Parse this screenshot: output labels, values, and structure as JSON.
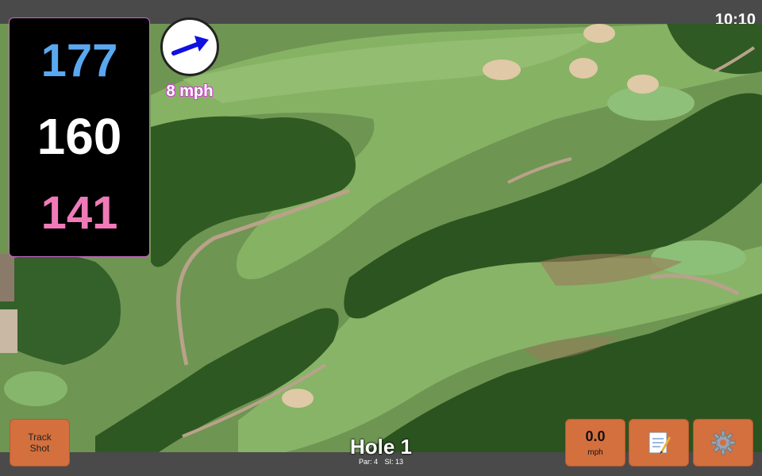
{
  "status": {
    "time": "10:10"
  },
  "distances": {
    "back": "177",
    "middle": "160",
    "front": "141",
    "colors": {
      "back": "#5aa8f0",
      "middle": "#ffffff",
      "front": "#f07ab8"
    }
  },
  "wind": {
    "speed_label": "8 mph",
    "direction_icon": "arrow-east-northeast-icon",
    "arrow_color": "#1010e0"
  },
  "buttons": {
    "track_shot_line1": "Track",
    "track_shot_line2": "Shot",
    "speed_value": "0.0",
    "speed_unit": "mph",
    "notes_icon": "notepad-icon",
    "settings_icon": "gear-icon",
    "button_color": "#d4703e"
  },
  "hole": {
    "title": "Hole 1",
    "par_label": "Par: 4",
    "si_label": "SI: 13"
  },
  "map": {
    "type": "aerial-golf-course"
  }
}
